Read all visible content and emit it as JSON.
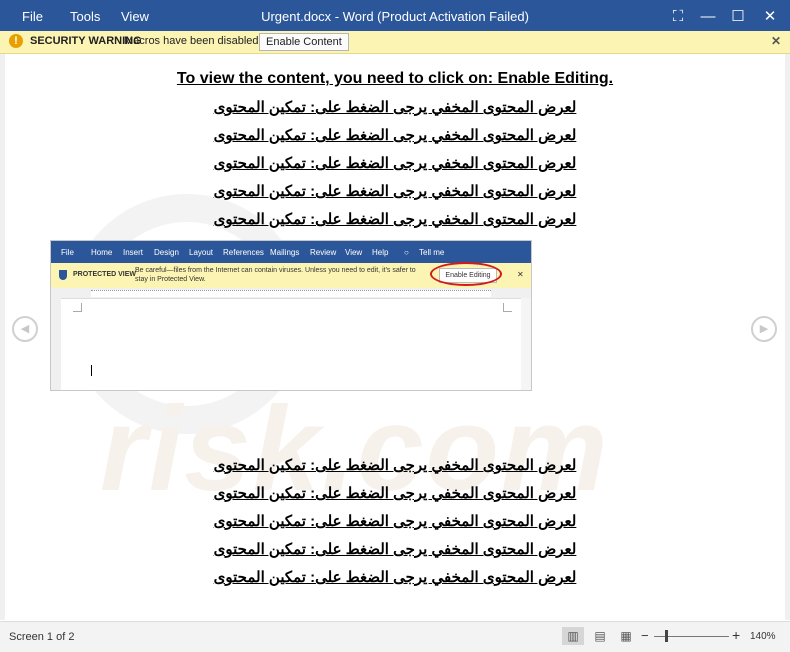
{
  "titlebar": {
    "menu": [
      "File",
      "Tools",
      "View"
    ],
    "title": "Urgent.docx - Word (Product Activation Failed)"
  },
  "security_bar": {
    "title": "SECURITY WARNING",
    "message": "Macros have been disabled.",
    "button": "Enable Content"
  },
  "document": {
    "heading": "To view the content, you need to click on: Enable Editing.",
    "arabic_line": "لعرض المحتوى المخفي يرجى الضغط على: تمكين المحتوى",
    "embedded": {
      "menu": [
        "File",
        "Home",
        "Insert",
        "Design",
        "Layout",
        "References",
        "Mailings",
        "Review",
        "View",
        "Help",
        "Tell me"
      ],
      "protected_title": "PROTECTED VIEW",
      "protected_msg": "Be careful—files from the Internet can contain viruses. Unless you need to edit, it's safer to stay in Protected View.",
      "button": "Enable Editing"
    }
  },
  "statusbar": {
    "screen": "Screen 1 of 2",
    "zoom": "140%",
    "zoom_fraction": 0.15
  },
  "colors": {
    "title_bar": "#2b579a",
    "warning_bar": "#fcf4b3",
    "highlight_ring": "#d21b1b"
  }
}
